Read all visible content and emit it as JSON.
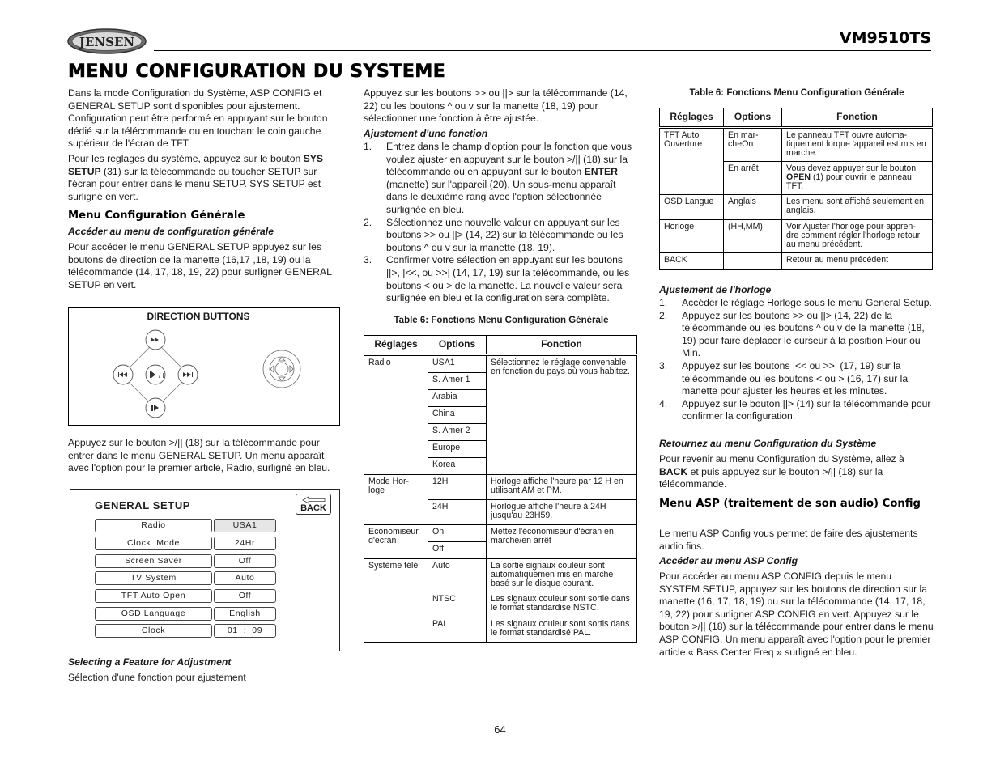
{
  "header": {
    "brand": "JENSEN",
    "model": "VM9510TS",
    "page_title": "MENU CONFIGURATION DU SYSTEME"
  },
  "col1": {
    "intro": "Dans la mode Configuration du Système, ASP CONFIG et GENERAL SETUP sont disponibles pour ajustement. Configuration peut être performé en appuyant sur le bouton dédié sur la télécommande ou en touchant le coin gauche supérieur de l'écran de TFT.",
    "sys_setup_pre": "Pour les réglages du système, appuyez sur le bouton ",
    "sys_setup_bold": "SYS SETUP",
    "sys_setup_post": " (31) sur la télécommande ou toucher SETUP sur l'écran pour entrer dans le menu SETUP. SYS SETUP est surligné en vert.",
    "section_heading": "Menu Configuration Générale",
    "subheading": "Accéder au menu de configuration générale",
    "access_text": "Pour accéder le menu GENERAL SETUP appuyez sur les boutons de direction de la manette (16,17 ,18, 19) ou la télécommande (14, 17, 18, 19, 22) pour surligner GENERAL SETUP en vert.",
    "diagram_title": "DIRECTION BUTTONS",
    "press_text": "Appuyez sur le bouton >/|| (18) sur la télécommande pour entrer dans le menu GENERAL SETUP. Un menu apparaît avec l'option pour le premier article, Radio, surligné en bleu.",
    "caption_title": "Selecting a Feature for Adjustment",
    "caption_text": "Sélection d'une fonction pour ajustement"
  },
  "direction_buttons": {
    "top": "fast-forward",
    "left": "skip-back",
    "center": "play-pause",
    "right": "skip-forward",
    "bottom": "step-play",
    "joystick": "joystick"
  },
  "general_setup": {
    "title": "GENERAL SETUP",
    "back_label": "BACK",
    "rows": [
      {
        "label": "Radio",
        "value": "USA1",
        "selected": true
      },
      {
        "label": "Clock  Mode",
        "value": "24Hr"
      },
      {
        "label": "Screen Saver",
        "value": "Off"
      },
      {
        "label": "TV System",
        "value": "Auto"
      },
      {
        "label": "TFT Auto Open",
        "value": "Off"
      },
      {
        "label": "OSD Language",
        "value": "English"
      },
      {
        "label": "Clock",
        "value": "01  :  09"
      }
    ]
  },
  "col2": {
    "intro": "Appuyez sur les boutons >> ou ||> sur la télécommande (14, 22) ou les boutons ^ ou v sur la manette (18, 19) pour sélectionner une fonction à être ajustée.",
    "subheading": "Ajustement d'une fonction",
    "steps": [
      {
        "num": "1.",
        "pre": "Entrez dans le champ d'option pour la fonction que vous voulez ajuster en appuyant sur le bouton >/|| (18) sur la télécommande ou en appuyant sur le bouton ",
        "bold": "ENTER",
        "post": " (manette)  sur l'appareil (20). Un sous-menu apparaît dans le deuxième rang avec l'option sélectionnée surlignée en bleu."
      },
      {
        "num": "2.",
        "pre": "Sélectionnez une nouvelle valeur en appuyant sur les boutons >> ou ||> (14, 22) sur la télécommande ou les boutons ^ ou v sur la manette (18, 19).",
        "bold": "",
        "post": ""
      },
      {
        "num": "3.",
        "pre": "Confirmer votre sélection en appuyant sur les boutons ||>, |<<, ou >>| (14, 17, 19) sur la télécommande, ou les boutons < ou > de la manette. La nouvelle valeur sera surlignée en bleu et la configuration sera complète.",
        "bold": "",
        "post": ""
      }
    ],
    "table_caption": "Table 6: Fonctions Menu Configuration Générale"
  },
  "table_a": {
    "headers": [
      "Réglages",
      "Options",
      "Fonction"
    ],
    "groups": [
      {
        "setting": "Radio",
        "function": "Sélectionnez le réglage convenable en fonction du pays où  vous habitez.",
        "options": [
          "USA1",
          "S. Amer 1",
          "Arabia",
          "China",
          "S. Amer 2",
          "Europe",
          "Korea"
        ]
      },
      {
        "setting": "Mode Hor-loge",
        "rows": [
          {
            "option": "12H",
            "function": "Horloge affiche l'heure par 12 H en utilisant AM et PM."
          },
          {
            "option": "24H",
            "function": "Horlogue affiche l'heure à 24H jusqu'au 23H59."
          }
        ]
      },
      {
        "setting": "Economiseur d'écran",
        "function": "Mettez l'économiseur d'écran en marche/en arrêt",
        "options": [
          "On",
          "Off"
        ]
      },
      {
        "setting": "Système télé",
        "rows": [
          {
            "option": "Auto",
            "function": "La sortie signaux couleur sont automatiquemen mis en marche basé sur le disque courant."
          },
          {
            "option": "NTSC",
            "function": "Les signaux couleur sont sortie dans le format standardisé NSTC."
          },
          {
            "option": "PAL",
            "function": "Les signaux couleur sont sortis dans le format standardisé PAL."
          }
        ]
      }
    ]
  },
  "col3": {
    "table_caption": "Table 6: Fonctions Menu Configuration Générale",
    "clock_heading": "Ajustement de l'horloge",
    "clock_steps": [
      {
        "num": "1.",
        "text": "Accéder le réglage Horloge sous le menu General Setup."
      },
      {
        "num": "2.",
        "text": "Appuyez sur les boutons >> ou ||> (14, 22) de la télécommande ou les boutons ^ ou v de la manette (18, 19) pour faire déplacer le curseur à la position Hour ou Min."
      },
      {
        "num": "3.",
        "text": "Appuyez sur les boutons |<< ou >>| (17, 19) sur la télécommande ou les boutons < ou > (16, 17) sur la manette pour ajuster les heures et les minutes."
      },
      {
        "num": "4.",
        "text": "Appuyez sur le bouton ||> (14) sur la télécommande pour confirmer la configuration."
      }
    ],
    "return_heading": "Retournez au menu Configuration du Système",
    "return_pre": "Pour revenir au menu Configuration du Système, allez à ",
    "return_bold": "BACK",
    "return_post": " et puis appuyez sur le bouton >/|| (18) sur la télécommande.",
    "asp_heading": "Menu ASP (traitement de son audio) Config",
    "asp_intro": "Le menu ASP Config vous permet de faire des ajustements audio fins.",
    "asp_subheading": "Accéder au menu ASP Config",
    "asp_text": "Pour accéder au menu ASP CONFIG depuis le menu SYSTEM SETUP, appuyez sur les boutons de direction sur la manette (16, 17, 18, 19) ou sur la télécommande (14, 17, 18, 19, 22) pour surligner ASP CONFIG en vert. Appuyez sur le bouton >/|| (18) sur la télécommande pour entrer dans le menu ASP CONFIG. Un menu apparaît avec l'option pour le premier article « Bass Center Freq » surligné en bleu."
  },
  "table_b": {
    "headers": [
      "Réglages",
      "Options",
      "Fonction"
    ],
    "groups": [
      {
        "setting": "TFT Auto Ouverture",
        "rows": [
          {
            "option": "En mar-cheOn",
            "function_pre": "Le panneau TFT ouvre automa-tiquement lorque 'appareil est mis en marche.",
            "function_bold": "",
            "function_post": ""
          },
          {
            "option": "En arrêt",
            "function_pre": "Vous devez appuyer sur le bouton ",
            "function_bold": "OPEN",
            "function_post": " (1) pour ouvrir le panneau TFT."
          }
        ]
      },
      {
        "setting": "OSD Langue",
        "option": "Anglais",
        "function": "Les menu sont affiché seulement en anglais."
      },
      {
        "setting": "Horloge",
        "option": "(HH,MM)",
        "function": "Voir Ajuster l'horloge pour appren-dre comment régler l'horloge retour au menu précédent."
      },
      {
        "setting": "BACK",
        "option": "",
        "function": "Retour au menu précédent"
      }
    ]
  },
  "footer": {
    "page_number": "64"
  }
}
